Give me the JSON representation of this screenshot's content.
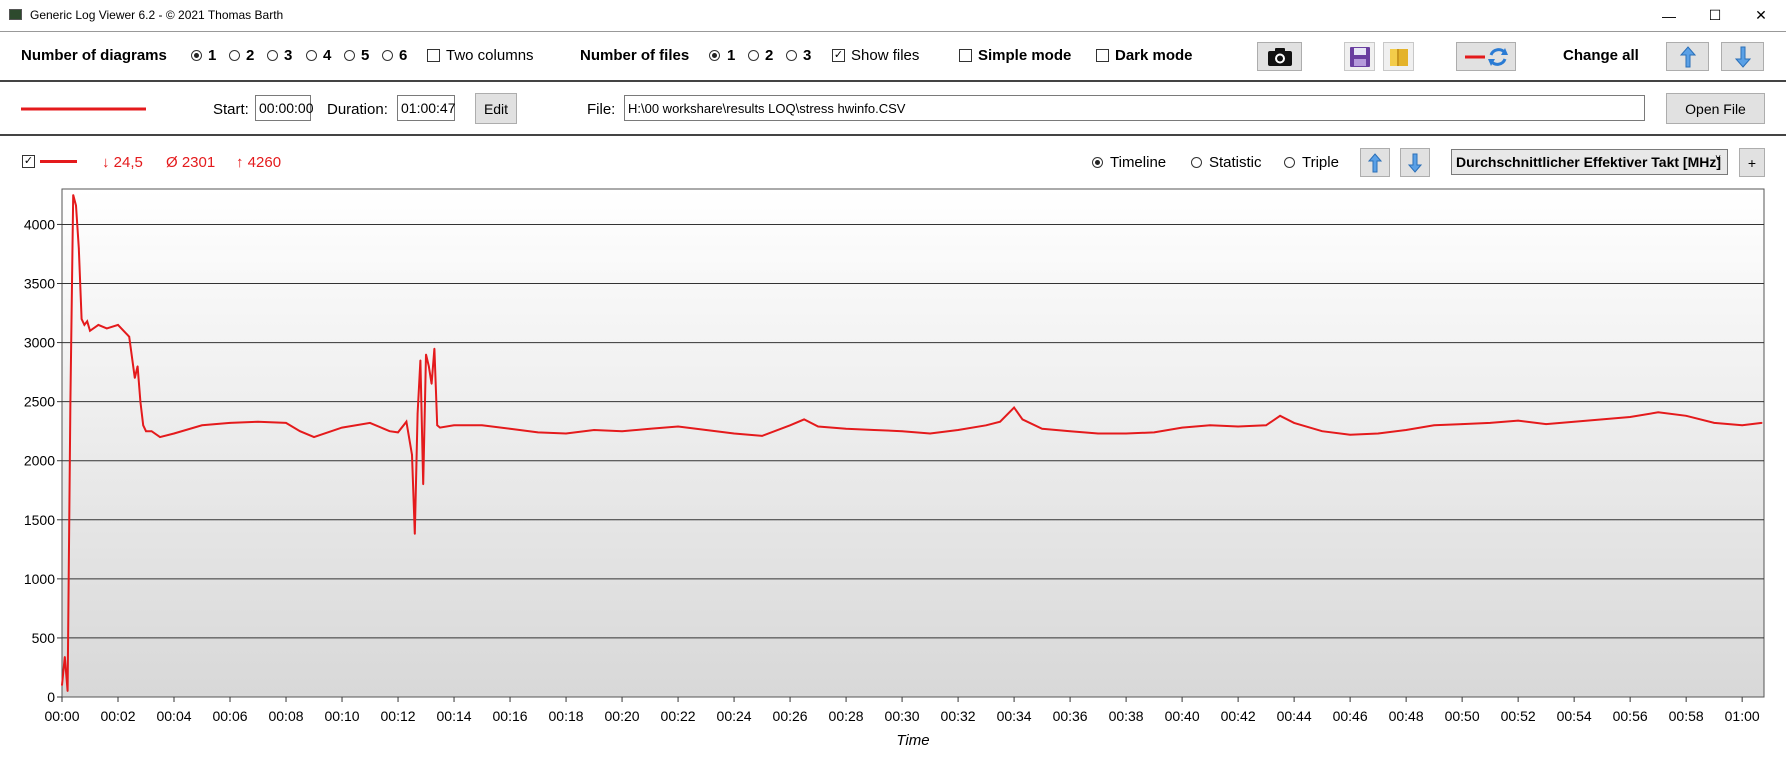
{
  "window": {
    "title": "Generic Log Viewer 6.2 - © 2021 Thomas Barth",
    "minimize": "—",
    "maximize": "☐",
    "close": "✕"
  },
  "toolbar": {
    "diagrams_label": "Number of diagrams",
    "diagram_options": [
      "1",
      "2",
      "3",
      "4",
      "5",
      "6"
    ],
    "diagram_selected": 0,
    "two_columns_label": "Two columns",
    "files_label": "Number of files",
    "file_options": [
      "1",
      "2",
      "3"
    ],
    "file_selected": 0,
    "show_files_label": "Show files",
    "show_files_checked": true,
    "simple_mode_label": "Simple mode",
    "dark_mode_label": "Dark mode",
    "change_all_label": "Change all"
  },
  "file_row": {
    "start_label": "Start:",
    "start_value": "00:00:00",
    "duration_label": "Duration:",
    "duration_value": "01:00:47",
    "edit_label": "Edit",
    "file_label": "File:",
    "file_path": "H:\\00 workshare\\results LOQ\\stress hwinfo.CSV",
    "open_file_label": "Open File",
    "line_color": "#e41a1c"
  },
  "diagram": {
    "min_value": "↓ 24,5",
    "avg_value": "Ø 2301",
    "max_value": "↑ 4260",
    "view_options": [
      "Timeline",
      "Statistic",
      "Triple"
    ],
    "view_selected": 0,
    "sensor": "Durchschnittlicher Effektiver Takt [MHz]",
    "add_label": "+"
  },
  "chart_data": {
    "type": "line",
    "title": "",
    "xlabel": "Time",
    "ylabel": "",
    "ylim": [
      0,
      4300
    ],
    "xlim_minutes": [
      0,
      60.78
    ],
    "y_ticks": [
      0,
      500,
      1000,
      1500,
      2000,
      2500,
      3000,
      3500,
      4000
    ],
    "x_tick_labels": [
      "00:00",
      "00:02",
      "00:04",
      "00:06",
      "00:08",
      "00:10",
      "00:12",
      "00:14",
      "00:16",
      "00:18",
      "00:20",
      "00:22",
      "00:24",
      "00:26",
      "00:28",
      "00:30",
      "00:32",
      "00:34",
      "00:36",
      "00:38",
      "00:40",
      "00:42",
      "00:44",
      "00:46",
      "00:48",
      "00:50",
      "00:52",
      "00:54",
      "00:56",
      "00:58",
      "01:00"
    ],
    "grid": true,
    "series": [
      {
        "color": "#e41a1c",
        "x_minutes": [
          0,
          0.1,
          0.2,
          0.3,
          0.4,
          0.5,
          0.6,
          0.7,
          0.8,
          0.9,
          1.0,
          1.3,
          1.6,
          2.0,
          2.4,
          2.6,
          2.7,
          2.8,
          2.9,
          3.0,
          3.2,
          3.5,
          4,
          5,
          6,
          7,
          8,
          8.5,
          9,
          10,
          11,
          11.5,
          11.7,
          12,
          12.3,
          12.5,
          12.6,
          12.7,
          12.8,
          12.9,
          13.0,
          13.1,
          13.2,
          13.3,
          13.4,
          13.5,
          14,
          15,
          16,
          17,
          18,
          19,
          20,
          21,
          22,
          23,
          24,
          25,
          26,
          26.5,
          27,
          28,
          29,
          30,
          31,
          32,
          33,
          33.5,
          34,
          34.3,
          35,
          36,
          37,
          38,
          39,
          40,
          41,
          42,
          43,
          43.5,
          44,
          45,
          46,
          47,
          48,
          49,
          50,
          51,
          52,
          53,
          54,
          55,
          56,
          57,
          58,
          59,
          60,
          60.7
        ],
        "y": [
          100,
          340,
          50,
          2500,
          4250,
          4160,
          3800,
          3200,
          3150,
          3180,
          3100,
          3150,
          3120,
          3150,
          3050,
          2700,
          2800,
          2500,
          2300,
          2250,
          2250,
          2200,
          2230,
          2300,
          2320,
          2330,
          2320,
          2250,
          2200,
          2280,
          2320,
          2270,
          2250,
          2240,
          2330,
          2050,
          1380,
          2400,
          2850,
          1800,
          2900,
          2800,
          2650,
          2950,
          2300,
          2280,
          2300,
          2300,
          2270,
          2240,
          2230,
          2260,
          2250,
          2270,
          2290,
          2260,
          2230,
          2210,
          2300,
          2350,
          2290,
          2270,
          2260,
          2250,
          2230,
          2260,
          2300,
          2330,
          2450,
          2350,
          2270,
          2250,
          2230,
          2230,
          2240,
          2280,
          2300,
          2290,
          2300,
          2380,
          2320,
          2250,
          2220,
          2230,
          2260,
          2300,
          2310,
          2320,
          2340,
          2310,
          2330,
          2350,
          2370,
          2410,
          2380,
          2320,
          2300,
          2320
        ]
      }
    ]
  }
}
